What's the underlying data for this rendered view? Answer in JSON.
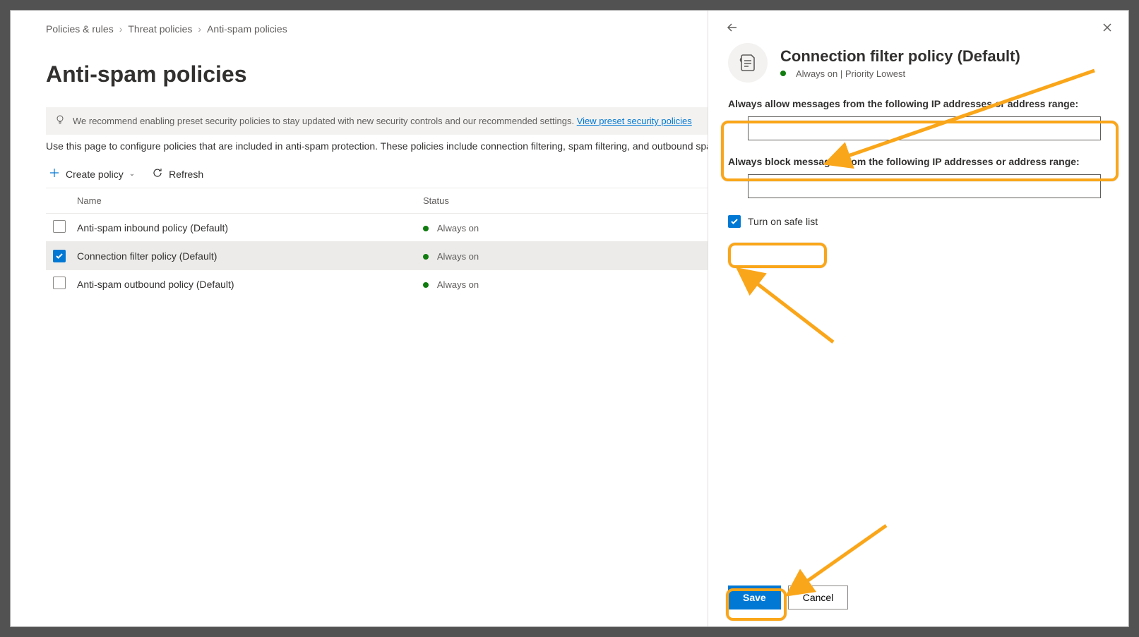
{
  "breadcrumb": {
    "items": [
      "Policies & rules",
      "Threat policies",
      "Anti-spam policies"
    ]
  },
  "page": {
    "title": "Anti-spam policies",
    "info_text": "We recommend enabling preset security policies to stay updated with new security controls and our recommended settings. ",
    "info_link": "View preset security policies",
    "description": "Use this page to configure policies that are included in anti-spam protection. These policies include connection filtering, spam filtering, and outbound spam"
  },
  "toolbar": {
    "create_label": "Create policy",
    "refresh_label": "Refresh"
  },
  "table": {
    "headers": {
      "name": "Name",
      "status": "Status"
    },
    "rows": [
      {
        "name": "Anti-spam inbound policy (Default)",
        "status": "Always on",
        "checked": false,
        "selected": false
      },
      {
        "name": "Connection filter policy (Default)",
        "status": "Always on",
        "checked": true,
        "selected": true
      },
      {
        "name": "Anti-spam outbound policy (Default)",
        "status": "Always on",
        "checked": false,
        "selected": false
      }
    ]
  },
  "panel": {
    "title": "Connection filter policy (Default)",
    "subtitle": "Always on | Priority Lowest",
    "allow_label": "Always allow messages from the following IP addresses or address range:",
    "allow_value": "",
    "block_label": "Always block messages from the following IP addresses or address range:",
    "block_value": "",
    "safelist_label": "Turn on safe list",
    "safelist_checked": true,
    "save_label": "Save",
    "cancel_label": "Cancel"
  }
}
